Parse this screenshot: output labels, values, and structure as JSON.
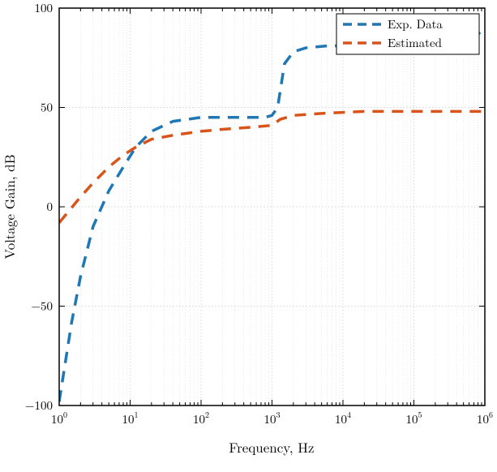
{
  "chart_data": {
    "type": "line",
    "xlabel": "Frequency, Hz",
    "ylabel": "Voltage Gain, dB",
    "xscale": "log",
    "xlim": [
      1,
      1000000
    ],
    "ylim": [
      -100,
      100
    ],
    "xticks": [
      1,
      10,
      100,
      1000,
      10000,
      100000,
      1000000
    ],
    "xtick_labels": [
      "10^0",
      "10^1",
      "10^2",
      "10^3",
      "10^4",
      "10^5",
      "10^6"
    ],
    "yticks": [
      -100,
      -50,
      0,
      50,
      100
    ],
    "ytick_labels": [
      "-100",
      "-50",
      "0",
      "50",
      "100"
    ],
    "series": [
      {
        "name": "Exp. Data",
        "color": "#1f77b4",
        "x": [
          1,
          1.5,
          2,
          3,
          5,
          8,
          12,
          20,
          40,
          100,
          200,
          500,
          800,
          1000,
          1200,
          1500,
          2000,
          3000,
          6000,
          15000,
          50000,
          200000,
          700000,
          1000000
        ],
        "y": [
          -98,
          -58,
          -35,
          -10,
          8,
          20,
          30,
          38,
          43,
          45,
          45,
          45,
          45,
          46,
          50,
          72,
          78,
          80,
          81,
          81,
          82,
          83,
          85,
          90
        ]
      },
      {
        "name": "Estimated",
        "color": "#d9541a",
        "x": [
          1,
          2,
          3,
          5,
          8,
          12,
          20,
          40,
          100,
          200,
          500,
          1000,
          1300,
          2000,
          5000,
          20000,
          100000,
          1000000
        ],
        "y": [
          -8,
          5,
          12,
          20,
          26,
          30,
          34,
          36,
          38,
          39,
          40,
          41,
          44,
          46,
          47,
          48,
          48,
          48
        ]
      }
    ],
    "grid": true,
    "legend_position": "upper right"
  }
}
